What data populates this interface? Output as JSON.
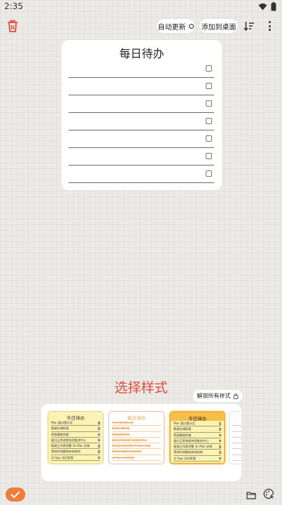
{
  "status_bar": {
    "time": "2:35"
  },
  "toolbar": {
    "auto_update_label": "自动更新",
    "add_to_desktop_label": "添加到桌面"
  },
  "todo_card": {
    "title": "每日待办",
    "rows": 7
  },
  "style_section": {
    "title": "选择样式",
    "unlock_all_label": "解锁所有样式"
  },
  "style_presets": [
    {
      "title": "今日待办",
      "items": [
        "Mac 窗口提示至",
        "数据存储权限",
        "界面精细完善",
        "窗口正常流程持续推进中心",
        "微调工作表完整 3x Mac 封装",
        "滑块的测量结构体结构",
        "对 App 访问权限"
      ]
    },
    {
      "title": "每日待办",
      "items": [
        "Mac 窗口提示至",
        "数据存储权限",
        "界面精细完善",
        "窗口正常流程持续推进中心",
        "微调工作表完整 3x Mac 封装",
        "滑块的测量结构体结构",
        "对 App 访问权限"
      ]
    },
    {
      "title": "今日待办",
      "items": [
        "Mac 窗口提示至",
        "数据存储权限",
        "界面精细完善",
        "窗口正常流程持续推进中心",
        "微调工作表完整 3x Mac 封装",
        "滑块的测量结构体结构",
        "对 App 访问权限"
      ]
    }
  ],
  "colors": {
    "accent": "#f07c3a",
    "section_title": "#e54b3c",
    "style_highlight": "#f3b33a"
  },
  "icons": {
    "trash": "trash-icon",
    "sort": "sort-icon",
    "more": "more-vertical-icon",
    "check": "check-icon",
    "folder": "folder-icon",
    "palette": "palette-icon",
    "lock": "lock-icon"
  }
}
